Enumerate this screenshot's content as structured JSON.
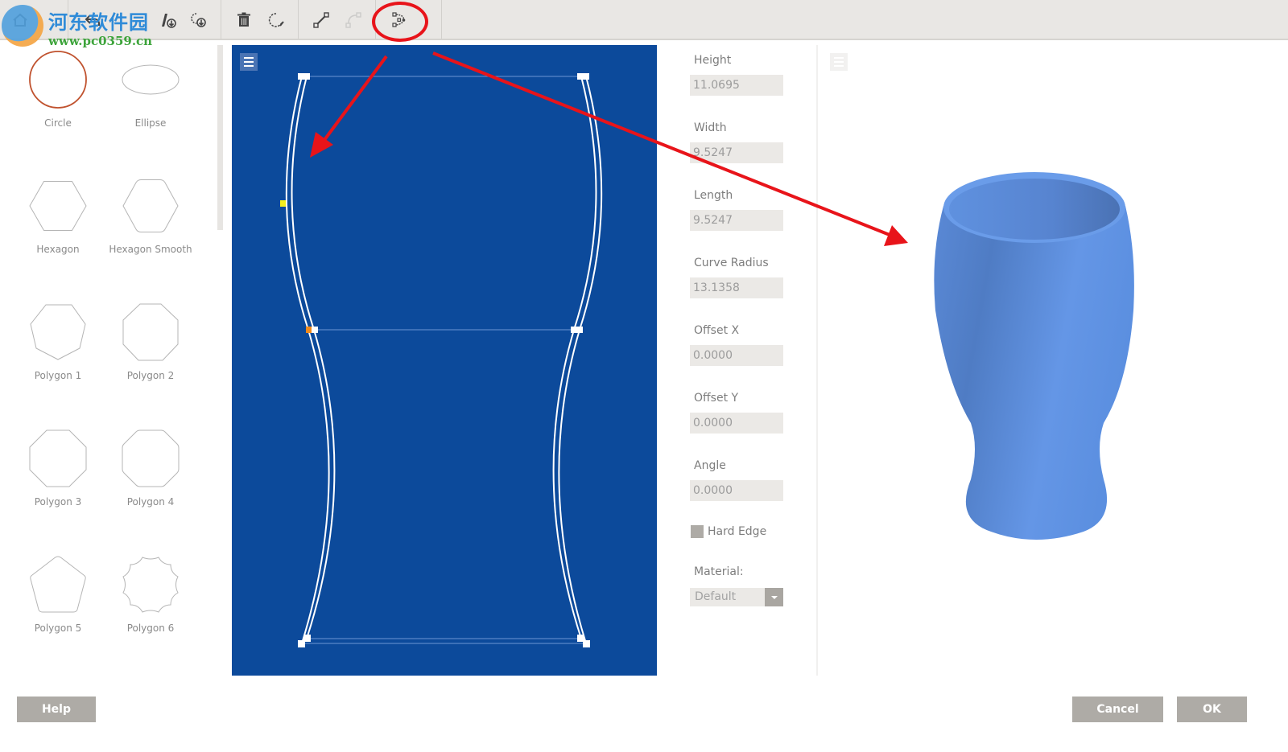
{
  "toolbar": {
    "buttons": [
      {
        "name": "home",
        "icon": "home-icon",
        "enabled": true
      },
      {
        "name": "undo",
        "icon": "undo-icon",
        "enabled": true
      },
      {
        "name": "import-profile",
        "icon": "import-profile-icon",
        "enabled": true
      },
      {
        "name": "import-shape",
        "icon": "import-shape-icon",
        "enabled": true
      },
      {
        "name": "delete",
        "icon": "trash-icon",
        "enabled": true
      },
      {
        "name": "edit-shape",
        "icon": "edit-shape-icon",
        "enabled": true
      },
      {
        "name": "add-line",
        "icon": "line-segment-icon",
        "enabled": true
      },
      {
        "name": "add-curve",
        "icon": "curve-segment-icon",
        "enabled": false
      },
      {
        "name": "convert-to-curve",
        "icon": "curve-convert-icon",
        "enabled": true,
        "highlighted": true
      }
    ]
  },
  "watermark": {
    "title": "河东软件园",
    "url": "www.pc0359.cn"
  },
  "palette": {
    "items": [
      {
        "label": "Circle",
        "shape": "circle",
        "selected": true
      },
      {
        "label": "Ellipse",
        "shape": "ellipse"
      },
      {
        "label": "Hexagon",
        "shape": "hexagon"
      },
      {
        "label": "Hexagon Smooth",
        "shape": "hexagon-smooth"
      },
      {
        "label": "Polygon 1",
        "shape": "heptagon"
      },
      {
        "label": "Polygon 2",
        "shape": "nonagon"
      },
      {
        "label": "Polygon 3",
        "shape": "octagon"
      },
      {
        "label": "Polygon 4",
        "shape": "octagon-smooth"
      },
      {
        "label": "Polygon 5",
        "shape": "pentagon"
      },
      {
        "label": "Polygon 6",
        "shape": "wavy"
      }
    ]
  },
  "properties": {
    "height": {
      "label": "Height",
      "value": "11.0695"
    },
    "width": {
      "label": "Width",
      "value": "9.5247"
    },
    "length": {
      "label": "Length",
      "value": "9.5247"
    },
    "curve_radius": {
      "label": "Curve Radius",
      "value": "13.1358"
    },
    "offset_x": {
      "label": "Offset X",
      "value": "0.0000"
    },
    "offset_y": {
      "label": "Offset Y",
      "value": "0.0000"
    },
    "angle": {
      "label": "Angle",
      "value": "0.0000"
    },
    "hard_edge": {
      "label": "Hard Edge",
      "checked": false
    },
    "material": {
      "label": "Material:",
      "value": "Default"
    }
  },
  "colors": {
    "editor_bg": "#0c4a9b",
    "preview_model": "#5b8fe0",
    "annotation": "#e8141a",
    "selected_point": "#f08a1c",
    "active_point": "#f3ef1e"
  },
  "footer": {
    "help": "Help",
    "cancel": "Cancel",
    "ok": "OK"
  }
}
